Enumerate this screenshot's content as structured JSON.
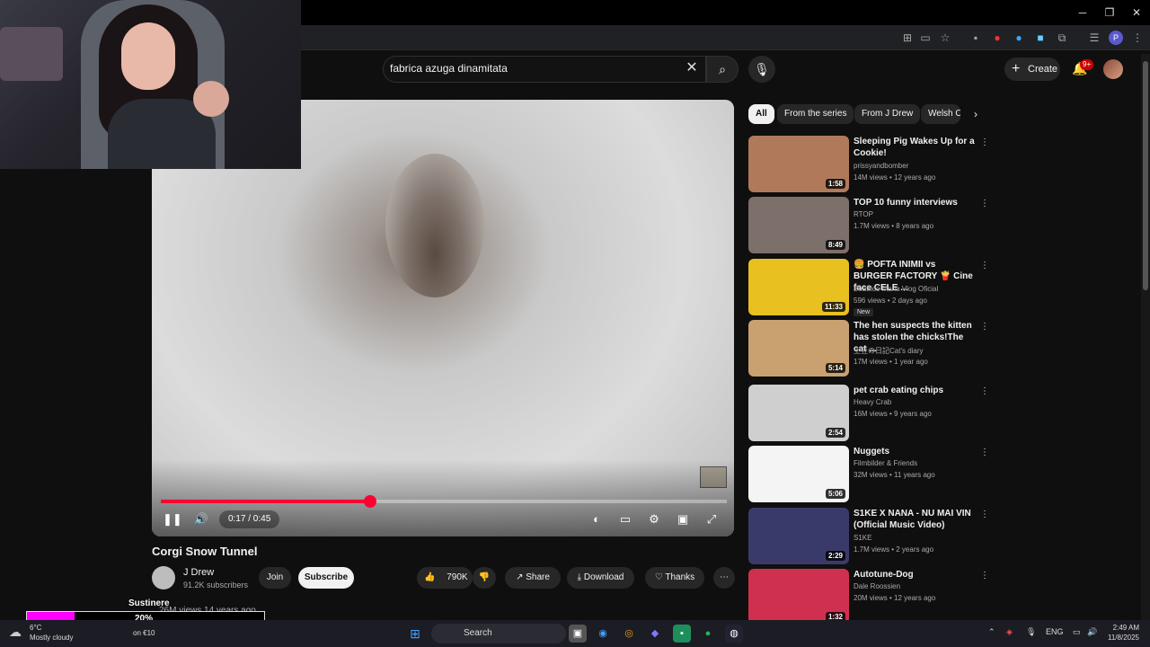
{
  "search": {
    "query": "fabrica azuga dinamitata"
  },
  "header": {
    "create_label": "Create",
    "notif_count": "9+"
  },
  "player": {
    "time": "0:17 / 0:45",
    "progress": 0.37
  },
  "video": {
    "title": "Corgi Snow Tunnel",
    "channel": "J Drew",
    "subscribers": "91.2K subscribers",
    "join_label": "Join",
    "subscribe_label": "Subscribe",
    "likes": "790K",
    "share_label": "Share",
    "download_label": "Download",
    "thanks_label": "Thanks",
    "views": "26M views  14 years ago"
  },
  "chips": [
    "All",
    "From the series",
    "From J Drew",
    "Welsh C"
  ],
  "recommendations": [
    {
      "title": "Sleeping Pig Wakes Up for a Cookie!",
      "channel": "prissyandbomber",
      "meta": "14M views • 12 years ago",
      "duration": "1:58",
      "color": "#b07a5a"
    },
    {
      "title": "TOP 10 funny interviews",
      "channel": "RTOP",
      "meta": "1.7M views • 8 years ago",
      "duration": "8:49",
      "color": "#7d6f6a"
    },
    {
      "title": "🍔 POFTA INIMII vs BURGER FACTORY 🍟 Cine face CELE ...",
      "channel": "Beatrice Maria Vlog Oficial",
      "meta": "596 views • 2 days ago",
      "duration": "11:33",
      "badge": "New",
      "color": "#e8c020"
    },
    {
      "title": "The hen suspects the kitten has stolen the chicks!The cat ...",
      "channel": "土豆の日記Cat's diary",
      "meta": "17M views • 1 year ago",
      "duration": "5:14",
      "color": "#c9a070"
    },
    {
      "title": "pet crab eating chips",
      "channel": "Heavy Crab",
      "meta": "16M views • 9 years ago",
      "duration": "2:54",
      "color": "#cfcfcf"
    },
    {
      "title": "Nuggets",
      "channel": "Filmbilder & Friends",
      "meta": "32M views • 11 years ago",
      "duration": "5:06",
      "color": "#f4f4f4"
    },
    {
      "title": "S1KE X NANA - NU MAI VIN (Official Music Video)",
      "channel": "S1KE",
      "meta": "1.7M views • 2 years ago",
      "duration": "2:29",
      "color": "#3a3a6a"
    },
    {
      "title": "Autotune-Dog",
      "channel": "Dale Roossien",
      "meta": "20M views • 12 years ago",
      "duration": "1:32",
      "color": "#d03050"
    }
  ],
  "overlay": {
    "label": "Sustinere",
    "percent": "20%",
    "fill": 0.2
  },
  "taskbar": {
    "weather_temp": "6°C",
    "weather_desc": "Mostly cloudy",
    "coin": "on €10",
    "search_label": "Search",
    "lang": "ENG",
    "time": "2:49 AM",
    "date": "11/8/2025"
  }
}
